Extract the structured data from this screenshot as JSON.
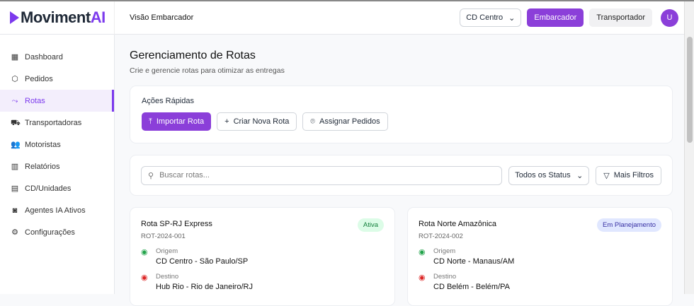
{
  "brand": {
    "name": "Moviment",
    "accent": "AI",
    "color": "#7c3aed"
  },
  "header": {
    "view": "Visão Embarcador",
    "cd_select": "CD Centro",
    "btn_embarcador": "Embarcador",
    "btn_transportador": "Transportador",
    "avatar": "U"
  },
  "sidebar": {
    "items": [
      {
        "label": "Dashboard",
        "icon": "grid-icon",
        "glyph": "▦"
      },
      {
        "label": "Pedidos",
        "icon": "package-icon",
        "glyph": "⬡"
      },
      {
        "label": "Rotas",
        "icon": "route-icon",
        "glyph": "⤳"
      },
      {
        "label": "Transportadoras",
        "icon": "truck-icon",
        "glyph": "⛟"
      },
      {
        "label": "Motoristas",
        "icon": "users-icon",
        "glyph": "👥"
      },
      {
        "label": "Relatórios",
        "icon": "chart-icon",
        "glyph": "▥"
      },
      {
        "label": "CD/Unidades",
        "icon": "warehouse-icon",
        "glyph": "▤"
      },
      {
        "label": "Agentes IA Ativos",
        "icon": "bot-icon",
        "glyph": "◙"
      },
      {
        "label": "Configurações",
        "icon": "gear-icon",
        "glyph": "⚙"
      }
    ]
  },
  "page": {
    "title": "Gerenciamento de Rotas",
    "subtitle": "Crie e gerencie rotas para otimizar as entregas"
  },
  "quick_actions": {
    "label": "Ações Rápidas",
    "import": "Importar Rota",
    "new": "Criar Nova Rota",
    "assign": "Assignar Pedidos"
  },
  "filters": {
    "search_placeholder": "Buscar rotas...",
    "status": "Todos os Status",
    "more": "Mais Filtros"
  },
  "routes": [
    {
      "name": "Rota SP-RJ Express",
      "id": "ROT-2024-001",
      "status": "Ativa",
      "status_bg": "#dcfce7",
      "status_color": "#15803d",
      "origin_label": "Origem",
      "origin": "CD Centro - São Paulo/SP",
      "dest_label": "Destino",
      "dest": "Hub Rio - Rio de Janeiro/RJ"
    },
    {
      "name": "Rota Norte Amazônica",
      "id": "ROT-2024-002",
      "status": "Em Planejamento",
      "status_bg": "#e0e7ff",
      "status_color": "#3730a3",
      "origin_label": "Origem",
      "origin": "CD Norte - Manaus/AM",
      "dest_label": "Destino",
      "dest": "CD Belém - Belém/PA"
    }
  ]
}
